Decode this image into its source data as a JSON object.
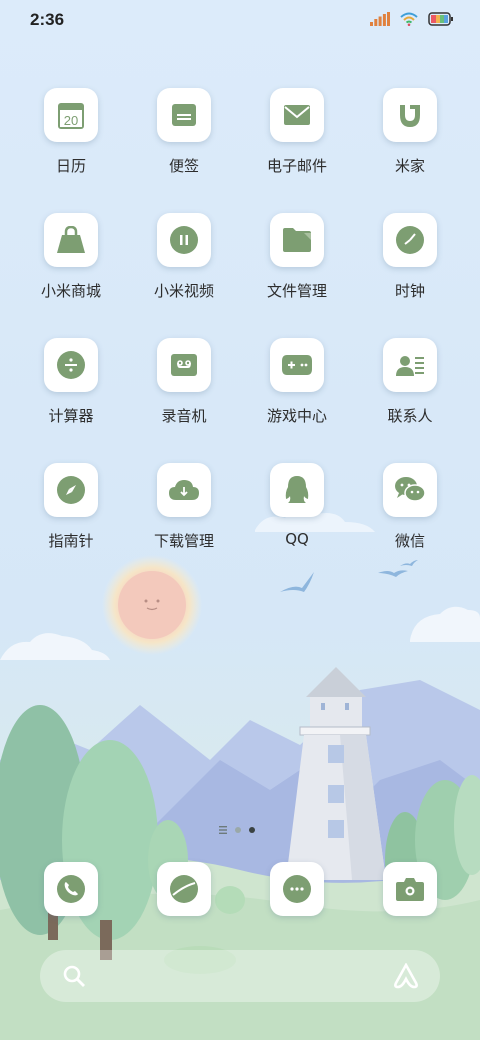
{
  "status_bar": {
    "time": "2:36",
    "icons": [
      "signal-icon",
      "wifi-icon",
      "battery-icon"
    ]
  },
  "apps": [
    {
      "label": "日历",
      "icon": "calendar-icon",
      "badge": "20"
    },
    {
      "label": "便签",
      "icon": "notes-icon"
    },
    {
      "label": "电子邮件",
      "icon": "mail-icon"
    },
    {
      "label": "米家",
      "icon": "mijia-icon"
    },
    {
      "label": "小米商城",
      "icon": "shopping-bag-icon"
    },
    {
      "label": "小米视频",
      "icon": "video-icon"
    },
    {
      "label": "文件管理",
      "icon": "folder-icon"
    },
    {
      "label": "时钟",
      "icon": "clock-icon"
    },
    {
      "label": "计算器",
      "icon": "calculator-icon"
    },
    {
      "label": "录音机",
      "icon": "recorder-icon"
    },
    {
      "label": "游戏中心",
      "icon": "gamepad-icon"
    },
    {
      "label": "联系人",
      "icon": "contacts-icon"
    },
    {
      "label": "指南针",
      "icon": "compass-icon"
    },
    {
      "label": "下载管理",
      "icon": "download-icon"
    },
    {
      "label": "QQ",
      "icon": "qq-icon"
    },
    {
      "label": "微信",
      "icon": "wechat-icon"
    }
  ],
  "dock": [
    {
      "icon": "phone-icon"
    },
    {
      "icon": "browser-icon"
    },
    {
      "icon": "messages-icon"
    },
    {
      "icon": "camera-icon"
    }
  ],
  "colors": {
    "icon_green": "#7d9e72",
    "tile_white": "#ffffff",
    "sky": "#d7e8f8"
  }
}
